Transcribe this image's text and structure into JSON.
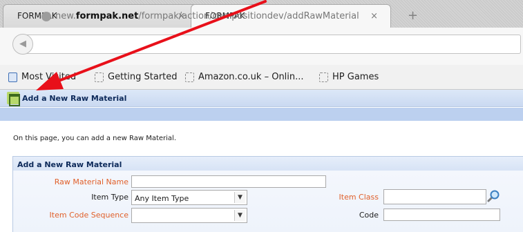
{
  "browser": {
    "tabs": [
      {
        "title": "FORMPAK",
        "active": false
      },
      {
        "title": "FORMPAK",
        "active": true
      }
    ],
    "close_glyph": "×",
    "new_tab_glyph": "+",
    "back_glyph": "◀",
    "url_prefix": "new.",
    "url_domain": "formpak.net",
    "url_path": "/formpak/action/compositiondev/addRawMaterial",
    "bookmarks": [
      {
        "label": "Most Visited",
        "icon": "most-visited-icon"
      },
      {
        "label": "Getting Started",
        "icon": "bookmark-page-icon"
      },
      {
        "label": "Amazon.co.uk – Onlin...",
        "icon": "bookmark-page-icon"
      },
      {
        "label": "HP Games",
        "icon": "bookmark-page-icon"
      }
    ]
  },
  "page": {
    "title": "Add a New Raw Material",
    "intro": "On this page, you can add a new Raw Material.",
    "form": {
      "title": "Add a New Raw Material",
      "fields": {
        "raw_material_name": {
          "label": "Raw Material Name",
          "value": ""
        },
        "item_type": {
          "label": "Item Type",
          "value": "Any Item Type"
        },
        "item_class": {
          "label": "Item Class",
          "value": ""
        },
        "item_code_sequence": {
          "label": "Item Code Sequence",
          "value": ""
        },
        "code": {
          "label": "Code",
          "value": ""
        }
      },
      "dropdown_glyph": "▼"
    }
  },
  "colors": {
    "required_label": "#e0602a",
    "header_bg": "#cad9f1",
    "annotation_arrow": "#e8101a"
  }
}
